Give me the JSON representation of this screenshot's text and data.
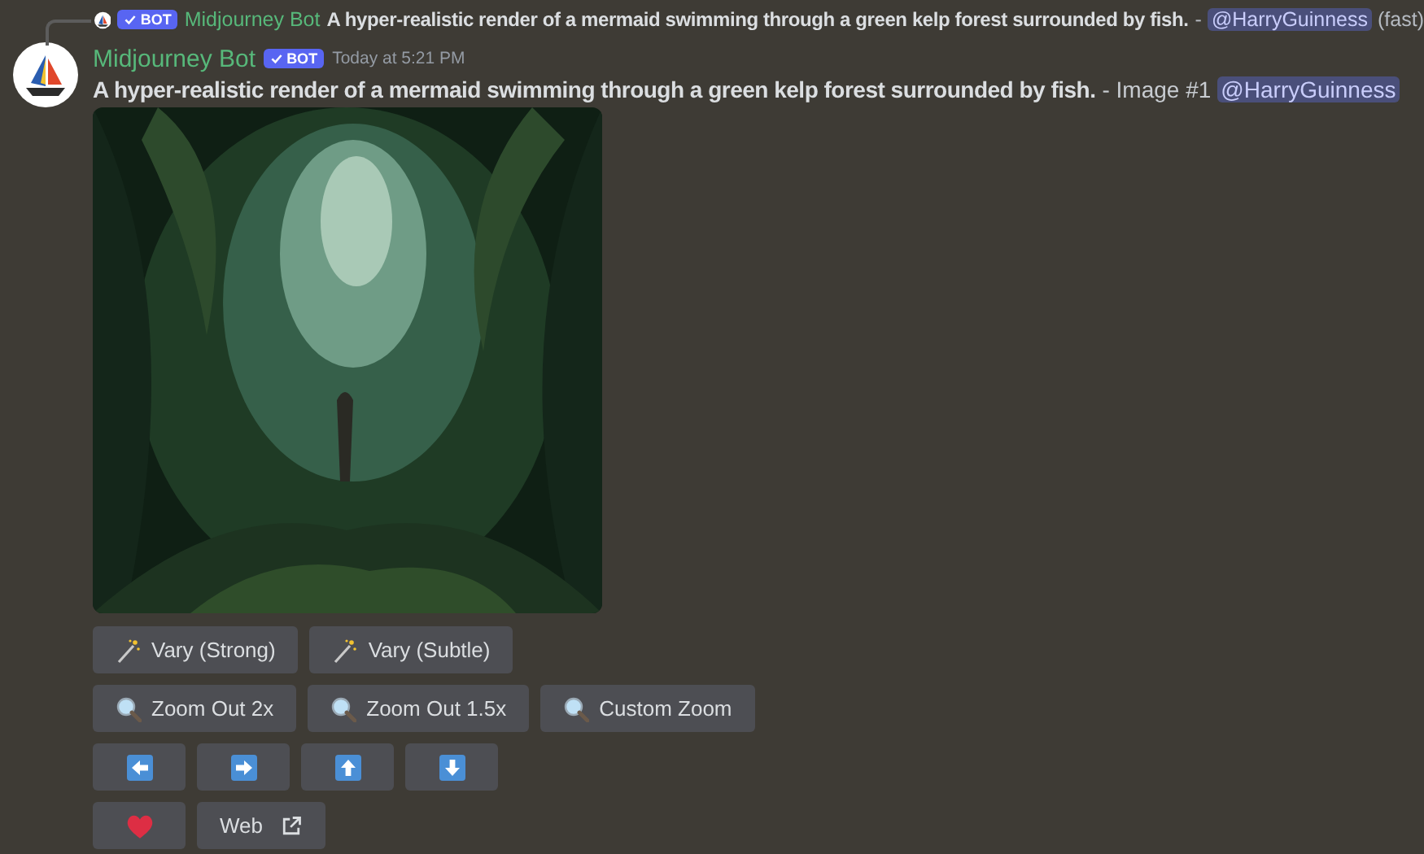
{
  "reply": {
    "author": "Midjourney Bot",
    "bot_tag": "BOT",
    "prompt": "A hyper-realistic render of a mermaid swimming through a green kelp forest surrounded by fish.",
    "separator": "-",
    "mention": "@HarryGuinness",
    "speed": "(fast)"
  },
  "message": {
    "author": "Midjourney Bot",
    "bot_tag": "BOT",
    "timestamp": "Today at 5:21 PM",
    "prompt": "A hyper-realistic render of a mermaid swimming through a green kelp forest surrounded by fish.",
    "suffix": "- Image #1",
    "mention": "@HarryGuinness"
  },
  "image": {
    "kind": "picture"
  },
  "button_rows": [
    [
      {
        "kind": "vary",
        "label": "Vary (Strong)"
      },
      {
        "kind": "vary",
        "label": "Vary (Subtle)"
      }
    ],
    [
      {
        "kind": "zoom",
        "label": "Zoom Out 2x"
      },
      {
        "kind": "zoom",
        "label": "Zoom Out 1.5x"
      },
      {
        "kind": "zoom",
        "label": "Custom Zoom"
      }
    ],
    [
      {
        "kind": "pan-left"
      },
      {
        "kind": "pan-right"
      },
      {
        "kind": "pan-up"
      },
      {
        "kind": "pan-down"
      }
    ],
    [
      {
        "kind": "favorite"
      },
      {
        "kind": "link",
        "label": "Web"
      }
    ]
  ]
}
